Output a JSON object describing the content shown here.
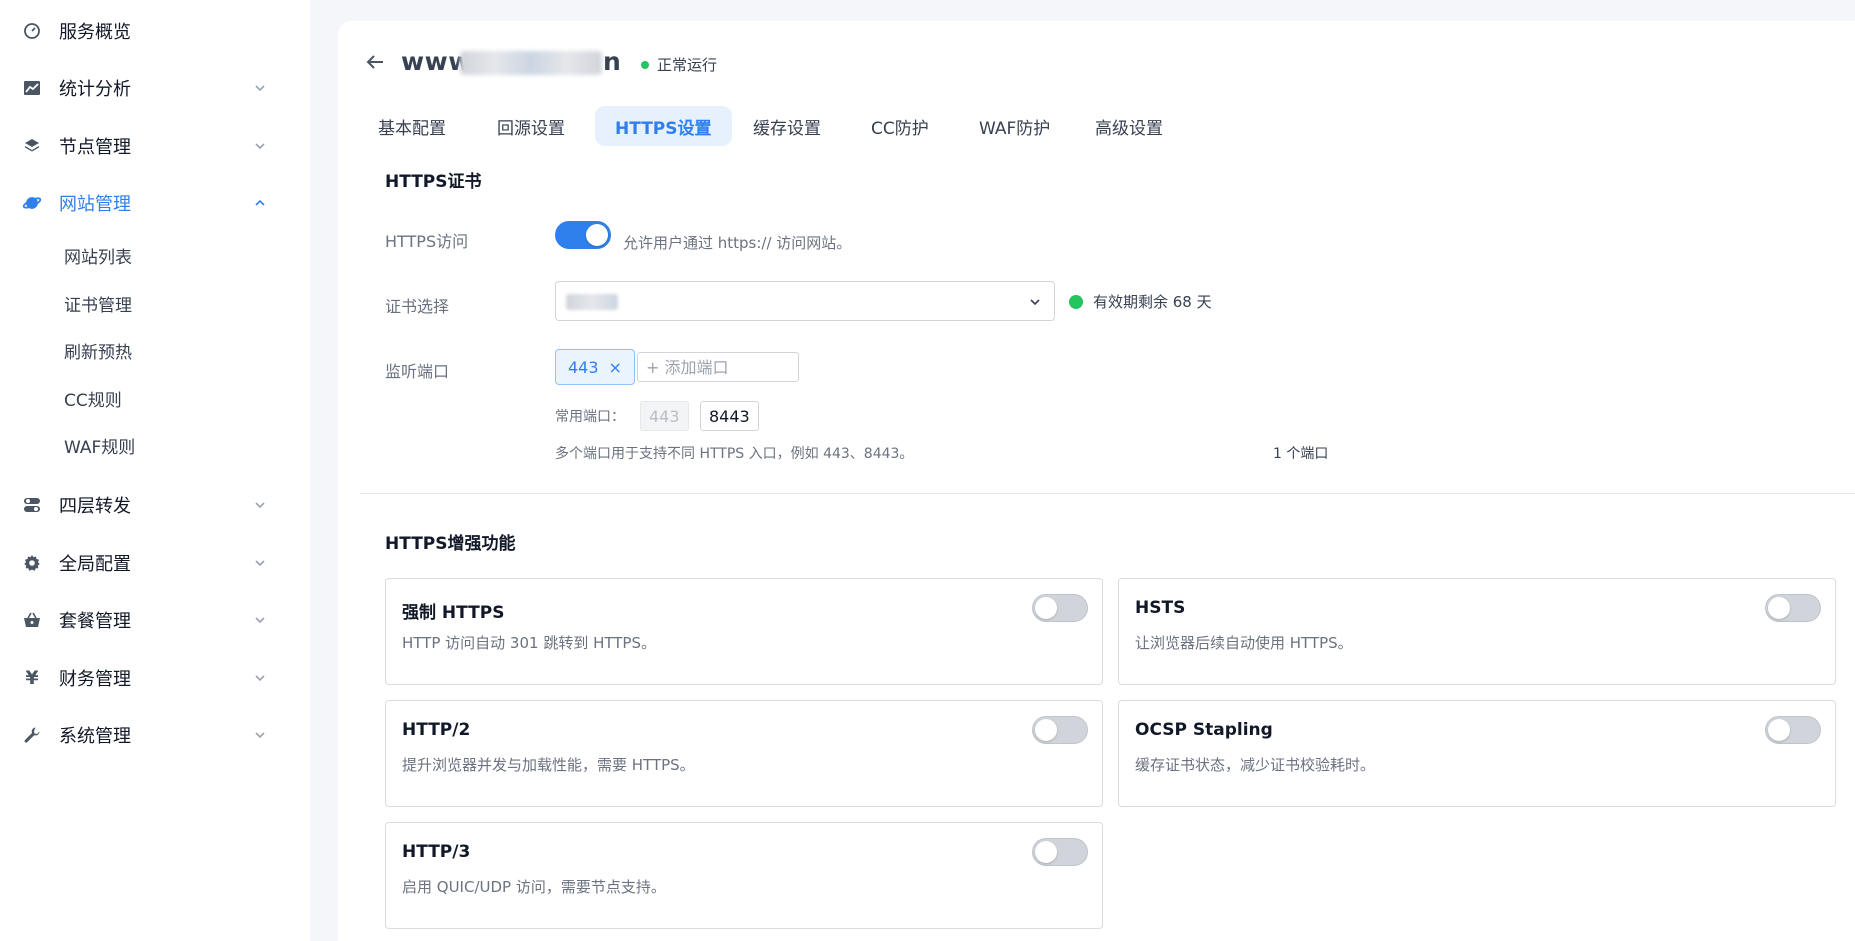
{
  "sidebar": {
    "items": [
      {
        "label": "服务概览",
        "icon": "gauge-icon"
      },
      {
        "label": "统计分析",
        "icon": "chart-icon"
      },
      {
        "label": "节点管理",
        "icon": "layers-icon"
      },
      {
        "label": "网站管理",
        "icon": "planet-icon"
      },
      {
        "label": "四层转发",
        "icon": "toggles-icon"
      },
      {
        "label": "全局配置",
        "icon": "gear-icon"
      },
      {
        "label": "套餐管理",
        "icon": "basket-icon"
      },
      {
        "label": "财务管理",
        "icon": "yen-icon"
      },
      {
        "label": "系统管理",
        "icon": "wrench-icon"
      }
    ],
    "sub_items": [
      "网站列表",
      "证书管理",
      "刷新预热",
      "CC规则",
      "WAF规则"
    ]
  },
  "header": {
    "site_prefix": "www",
    "site_suffix": "n",
    "status_text": "正常运行"
  },
  "tabs": [
    "基本配置",
    "回源设置",
    "HTTPS设置",
    "缓存设置",
    "CC防护",
    "WAF防护",
    "高级设置"
  ],
  "cert": {
    "section_title": "HTTPS证书",
    "https_access_label": "HTTPS访问",
    "https_access_hint": "允许用户通过 https:// 访问网站。",
    "https_access_on": true,
    "cert_select_label": "证书选择",
    "validity_text": "有效期剩余 68 天",
    "listen_port_label": "监听端口",
    "port_tag": "443",
    "port_tag_close": "×",
    "add_port_placeholder": "+ 添加端口",
    "common_ports_label": "常用端口：",
    "common_ports": [
      "443",
      "8443"
    ],
    "port_hint": "多个端口用于支持不同 HTTPS 入口，例如 443、8443。",
    "port_count": "1 个端口"
  },
  "enhance": {
    "section_title": "HTTPS增强功能",
    "features": [
      {
        "title": "强制 HTTPS",
        "desc": "HTTP 访问自动 301 跳转到 HTTPS。",
        "on": false
      },
      {
        "title": "HSTS",
        "desc": "让浏览器后续自动使用 HTTPS。",
        "on": false
      },
      {
        "title": "HTTP/2",
        "desc": "提升浏览器并发与加载性能，需要 HTTPS。",
        "on": false
      },
      {
        "title": "OCSP Stapling",
        "desc": "缓存证书状态，减少证书校验耗时。",
        "on": false
      },
      {
        "title": "HTTP/3",
        "desc": "启用 QUIC/UDP 访问，需要节点支持。",
        "on": false
      }
    ]
  },
  "colors": {
    "accent": "#2f80ed",
    "success": "#22c55e"
  }
}
